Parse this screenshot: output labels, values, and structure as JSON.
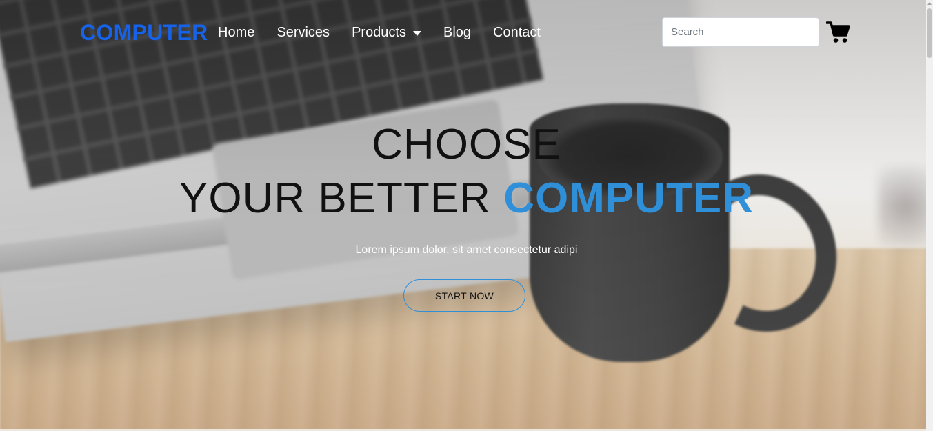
{
  "brand": {
    "name": "COMPUTER"
  },
  "nav": {
    "items": [
      {
        "label": "Home"
      },
      {
        "label": "Services"
      },
      {
        "label": "Products",
        "dropdown": true
      },
      {
        "label": "Blog"
      },
      {
        "label": "Contact"
      }
    ]
  },
  "search": {
    "placeholder": "Search",
    "value": ""
  },
  "cart": {
    "icon": "cart-icon"
  },
  "hero": {
    "line1": "CHOOSE",
    "line2_prefix": "YOUR BETTER",
    "line2_accent": "COMPUTER",
    "subtitle": "Lorem ipsum dolor, sit amet consectetur adipi",
    "cta_label": "START NOW"
  },
  "colors": {
    "brand": "#1663ea",
    "accent": "#2f8fd8",
    "nav_text": "#ffffff",
    "heading": "#111111"
  }
}
